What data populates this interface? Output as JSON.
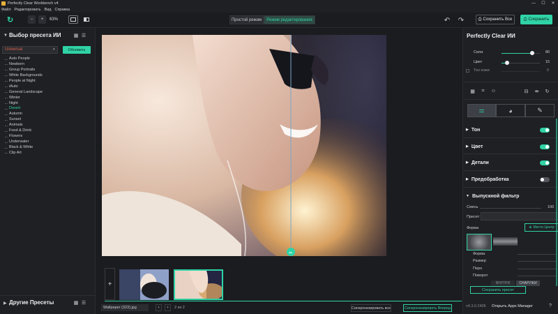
{
  "window": {
    "title": "Perfectly Clear Workbench v4",
    "controls": [
      "—",
      "☐",
      "✕"
    ]
  },
  "menu": [
    "Файл",
    "Редактировать",
    "Вид",
    "Справка"
  ],
  "toolbar": {
    "zoom_minus": "−",
    "zoom_plus": "+",
    "zoom_value": "63%",
    "mode_simple": "Простой режим",
    "mode_edit": "Режим редактирования",
    "save_all": "Сохранить Все",
    "save": "Сохранить"
  },
  "left_panel": {
    "title": "Выбор пресета ИИ",
    "select_value": "Universal",
    "update_button": "Обновить",
    "presets": [
      "Auto People",
      "Newborn",
      "Group Portraits",
      "White Backgrounds",
      "People at Night",
      "iAuto",
      "General Landscape",
      "Winter",
      "Night",
      "Desert",
      "Autumn",
      "Sunset",
      "Animals",
      "Food & Drink",
      "Flowers",
      "Underwater",
      "Black & White",
      "Clip Art"
    ],
    "selected_preset": "Desert",
    "other_presets": "Другие Пресеты"
  },
  "right_panel": {
    "title": "Perfectly Clear ИИ",
    "sliders": [
      {
        "label": "Сила",
        "value": "80",
        "level": 0.8
      },
      {
        "label": "Цвет",
        "value": "15",
        "level": 0.15
      }
    ],
    "skin_tone_label": "Тон кожи",
    "skin_tone_value": "0",
    "sections": [
      {
        "label": "Тон",
        "enabled": true
      },
      {
        "label": "Цвет",
        "enabled": true
      },
      {
        "label": "Детали",
        "enabled": true
      },
      {
        "label": "Предобработка",
        "enabled": false
      }
    ],
    "output_filter": {
      "title": "Выпускной фильтр",
      "mix_label": "Смесь",
      "mix_value": "100",
      "preset_label": "Пресет",
      "shape_label": "Форма",
      "shape_button": "Место Центр",
      "props": [
        "Форма",
        "Размер",
        "Перо",
        "Поворот"
      ],
      "save_preset": "Сохранить пресет",
      "tabs": [
        "ВНУТРИ",
        "СНАРУЖИ"
      ]
    },
    "version": "v4.3.0.2406",
    "apps_manager": "Открыть Apps Manager"
  },
  "bottom_bar": {
    "file_name": "Wallpaper (323).jpg",
    "page_info": "2 из 2",
    "sync_all": "Синхронизировать все",
    "sync_next": "Синхронизировать Вперед"
  },
  "colors": {
    "accent": "#2fd3a6",
    "panel": "#1f2023",
    "background": "#1b1c1f",
    "preset_select": "#e0604a"
  }
}
